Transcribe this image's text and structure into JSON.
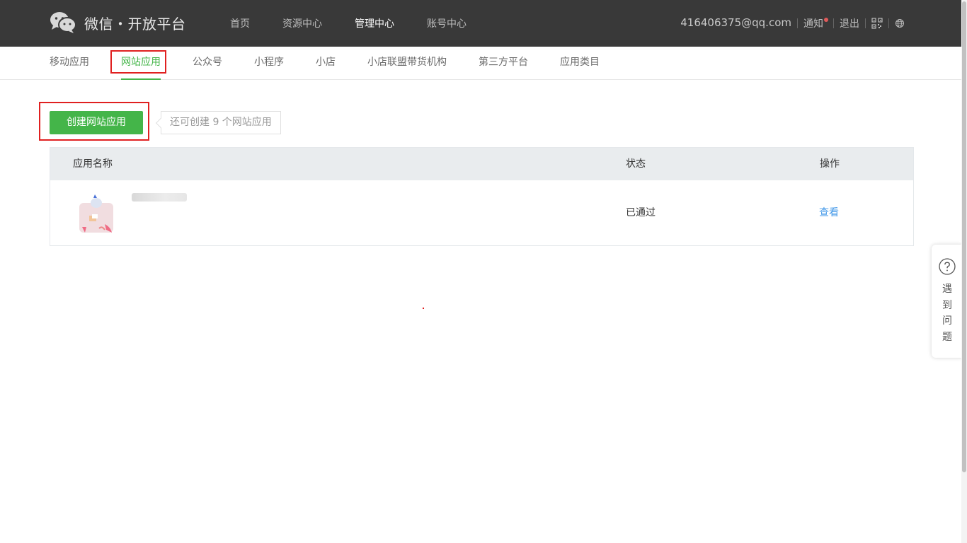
{
  "brand": {
    "title": "微信・开放平台"
  },
  "topnav": {
    "items": [
      {
        "label": "首页"
      },
      {
        "label": "资源中心"
      },
      {
        "label": "管理中心"
      },
      {
        "label": "账号中心"
      }
    ],
    "active_index": 2
  },
  "account": {
    "email": "416406375@qq.com",
    "notice_label": "通知",
    "logout_label": "退出"
  },
  "subnav": {
    "items": [
      {
        "label": "移动应用"
      },
      {
        "label": "网站应用"
      },
      {
        "label": "公众号"
      },
      {
        "label": "小程序"
      },
      {
        "label": "小店"
      },
      {
        "label": "小店联盟带货机构"
      },
      {
        "label": "第三方平台"
      },
      {
        "label": "应用类目"
      }
    ],
    "active_index": 1
  },
  "create": {
    "button_label": "创建网站应用",
    "tip": "还可创建 9 个网站应用"
  },
  "table": {
    "headers": {
      "name": "应用名称",
      "status": "状态",
      "action": "操作"
    },
    "rows": [
      {
        "status": "已通过",
        "action": "查看"
      }
    ]
  },
  "help": {
    "chars": [
      "遇",
      "到",
      "问",
      "题"
    ]
  },
  "colors": {
    "topbar_bg": "#393939",
    "accent_green": "#44b549",
    "link_blue": "#459ae9",
    "highlight_red": "#e02020"
  }
}
